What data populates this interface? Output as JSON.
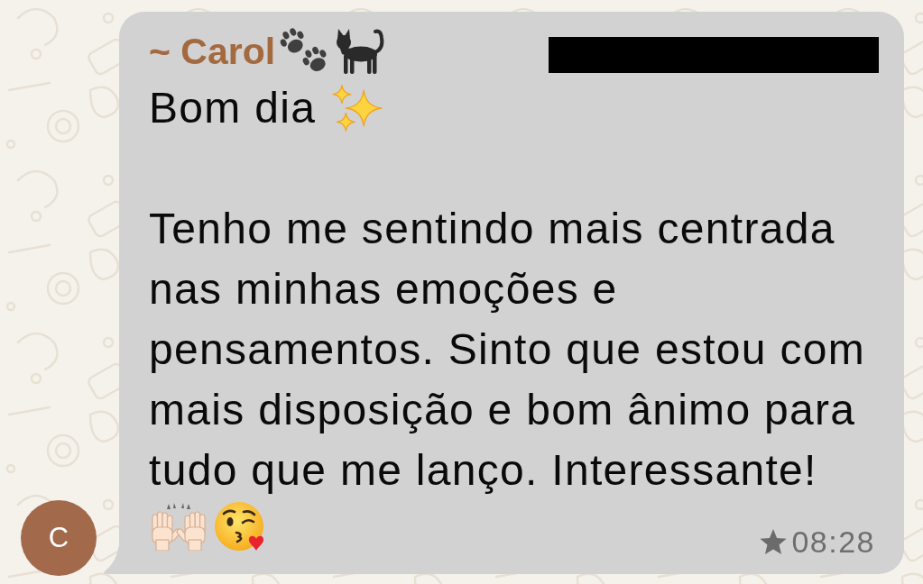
{
  "message": {
    "avatar": {
      "initial": "C"
    },
    "sender": {
      "name": "~ Carol"
    },
    "greeting": "Bom dia",
    "body": "Tenho me sentindo mais centrada nas minhas emoções e pensamentos. Sinto que estou com mais disposição e bom ânimo para tudo que me lanço. Interessante!",
    "starred": true,
    "time": "08:28"
  }
}
